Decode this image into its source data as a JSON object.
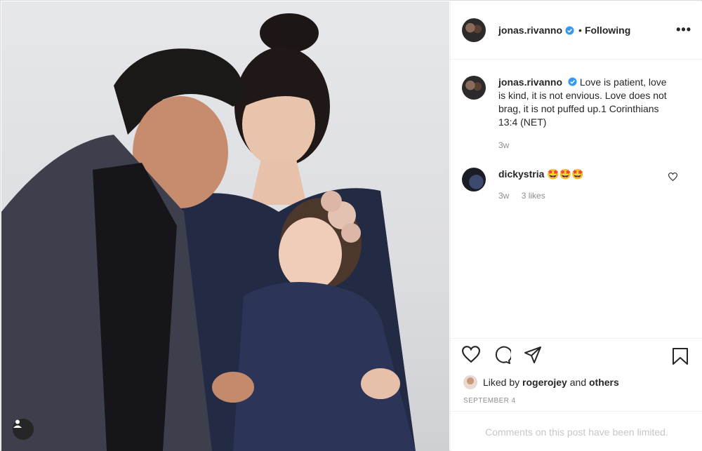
{
  "post": {
    "username": "jonas.rivanno",
    "follow_status": "Following",
    "more_icon": "more-options-icon",
    "caption_username": "jonas.rivanno",
    "caption_text": "Love is patient, love is kind, it is not envious. Love does not brag, it is not puffed up.1 Corinthians 13:4 (NET)",
    "caption_time": "3w",
    "comments": [
      {
        "username": "dickystria",
        "text": "🤩🤩🤩",
        "time": "3w",
        "likes": "3 likes"
      }
    ],
    "liked_by_prefix": "Liked by",
    "liked_by_user": "rogerojey",
    "liked_by_and": "and",
    "liked_by_others": "others",
    "date": "SEPTEMBER 4",
    "comments_limited": "Comments on this post have been limited."
  },
  "icons": {
    "like": "heart-icon",
    "comment": "comment-icon",
    "share": "share-icon",
    "save": "bookmark-icon",
    "tag": "user-tag-icon",
    "verified": "verified-badge-icon"
  },
  "colors": {
    "verified_blue": "#3897f0",
    "text": "#262626",
    "muted": "#8e8e8e"
  }
}
